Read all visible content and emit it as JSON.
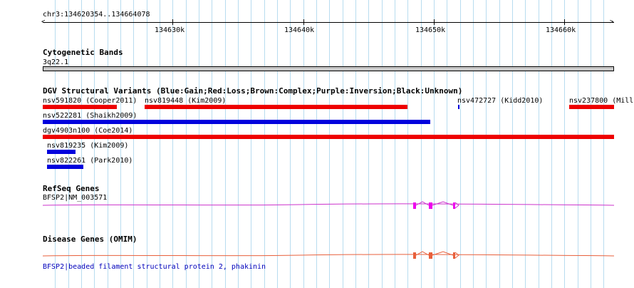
{
  "ruler": {
    "location": "chr3:134620354..134664078",
    "tick_labels": [
      "134630k",
      "134640k",
      "134650k",
      "134660k"
    ]
  },
  "tracks": {
    "cytoband": {
      "title": "Cytogenetic Bands",
      "band_label": "3q22.1"
    },
    "dgv": {
      "title": "DGV Structural Variants (Blue:Gain;Red:Loss;Brown:Complex;Purple:Inversion;Black:Unknown)",
      "features": [
        {
          "label": "nsv591820 (Cooper2011)",
          "color": "#ee0000"
        },
        {
          "label": "nsv819448 (Kim2009)",
          "color": "#ee0000"
        },
        {
          "label": "nsv472727 (Kidd2010)",
          "color": "#0000dd"
        },
        {
          "label": "nsv237800 (Mills",
          "color": "#ee0000"
        },
        {
          "label": "nsv522281 (Shaikh2009)",
          "color": "#0000dd"
        },
        {
          "label": "dgv4903n100 (Coe2014)",
          "color": "#ee0000"
        },
        {
          "label": "nsv819235 (Kim2009)",
          "color": "#0000dd"
        },
        {
          "label": "nsv822261 (Park2010)",
          "color": "#0000dd"
        }
      ]
    },
    "refseq": {
      "title": "RefSeq Genes",
      "gene_label": "BFSP2|NM_003571",
      "color": "#cc33cc",
      "exon_color": "#ee00ee"
    },
    "disease": {
      "title": "Disease Genes (OMIM)",
      "gene_label": "BFSP2|beaded filament structural protein 2, phakinin",
      "color": "#e8603c",
      "label_color": "#0000bb"
    }
  },
  "colors": {
    "grid": "#b8dcef"
  }
}
